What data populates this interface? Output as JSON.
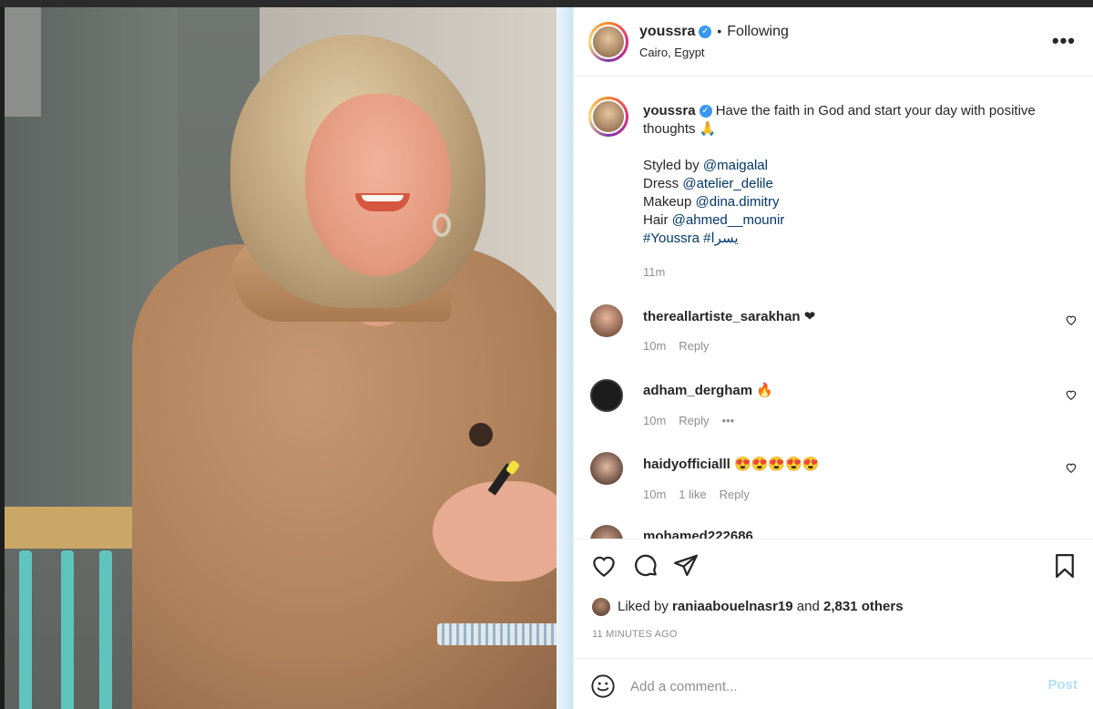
{
  "post": {
    "username": "youssra",
    "verified_icon": "verified-badge-icon",
    "separator": "•",
    "following_label": "Following",
    "location": "Cairo, Egypt",
    "more_icon": "more-options-icon",
    "more_label": "•••"
  },
  "caption": {
    "username": "youssra",
    "text": "Have the faith in God and start your day with positive thoughts 🙏",
    "lines": [
      {
        "prefix": "Styled by ",
        "mention": "@maigalal"
      },
      {
        "prefix": "Dress ",
        "mention": "@atelier_delile"
      },
      {
        "prefix": "Makeup ",
        "mention": "@dina.dimitry"
      },
      {
        "prefix": "Hair ",
        "mention": "@ahmed__mounir"
      }
    ],
    "hashtags": "#Youssra #يسرا",
    "time": "11m"
  },
  "comments": [
    {
      "username": "thereallartiste_sarakhan",
      "text": "❤",
      "time": "10m",
      "likes": "",
      "reply": "Reply",
      "more": ""
    },
    {
      "username": "adham_dergham",
      "text": "🔥",
      "time": "10m",
      "likes": "",
      "reply": "Reply",
      "more": "•••"
    },
    {
      "username": "haidyofficialll",
      "text": "😍😍😍😍😍",
      "time": "10m",
      "likes": "1 like",
      "reply": "Reply",
      "more": ""
    },
    {
      "username": "mohamed222686",
      "text": "",
      "time": "",
      "likes": "",
      "reply": "",
      "more": ""
    }
  ],
  "actions": {
    "like_icon": "heart-icon",
    "comment_icon": "comment-icon",
    "share_icon": "share-icon",
    "save_icon": "bookmark-icon"
  },
  "likes": {
    "prefix": "Liked by ",
    "user": "raniaabouelnasr19",
    "middle": " and ",
    "count": "2,831 others"
  },
  "timestamp": "11 MINUTES AGO",
  "add_comment": {
    "placeholder": "Add a comment...",
    "emoji_icon": "emoji-icon",
    "post_label": "Post"
  },
  "colors": {
    "link": "#00376b",
    "verified": "#3897f0",
    "muted": "#8e8e8e",
    "post_disabled": "#b2dffc"
  }
}
